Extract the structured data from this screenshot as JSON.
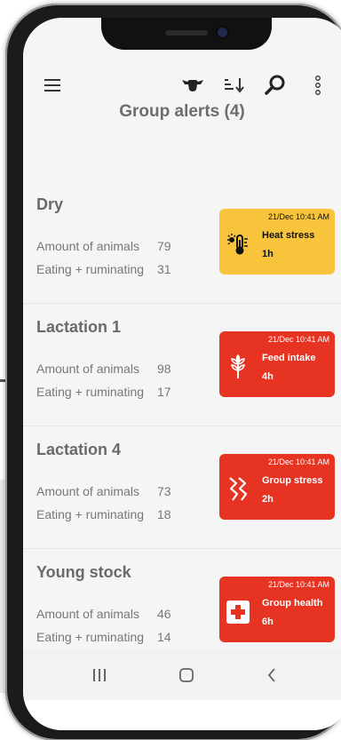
{
  "toolbar": {
    "icons": [
      "menu-icon",
      "cow-icon",
      "sort-icon",
      "search-icon",
      "more-vert-icon"
    ]
  },
  "title": "Group alerts (4)",
  "groups": [
    {
      "name": "Dry",
      "amount_label": "Amount of animals",
      "amount_value": "79",
      "eating_label": "Eating + ruminating",
      "eating_value": "31",
      "alert": {
        "timestamp": "21/Dec 10:41 AM",
        "name": "Heat stress",
        "duration": "1h",
        "icon": "thermometer-sun-icon",
        "color": "#f7c43c"
      }
    },
    {
      "name": "Lactation 1",
      "amount_label": "Amount of animals",
      "amount_value": "98",
      "eating_label": "Eating + ruminating",
      "eating_value": "17",
      "alert": {
        "timestamp": "21/Dec 10:41 AM",
        "name": "Feed intake",
        "duration": "4h",
        "icon": "wheat-icon",
        "color": "#e63322"
      }
    },
    {
      "name": "Lactation 4",
      "amount_label": "Amount of animals",
      "amount_value": "73",
      "eating_label": "Eating + ruminating",
      "eating_value": "18",
      "alert": {
        "timestamp": "21/Dec 10:41 AM",
        "name": "Group stress",
        "duration": "2h",
        "icon": "stress-zigzag-icon",
        "color": "#e63322"
      }
    },
    {
      "name": "Young stock",
      "amount_label": "Amount of animals",
      "amount_value": "46",
      "eating_label": "Eating + ruminating",
      "eating_value": "14",
      "alert": {
        "timestamp": "21/Dec 10:41 AM",
        "name": "Group health",
        "duration": "6h",
        "icon": "health-cross-icon",
        "color": "#e63322"
      }
    }
  ],
  "navbar": {
    "icons": [
      "recent-apps-icon",
      "home-icon",
      "back-icon"
    ]
  }
}
